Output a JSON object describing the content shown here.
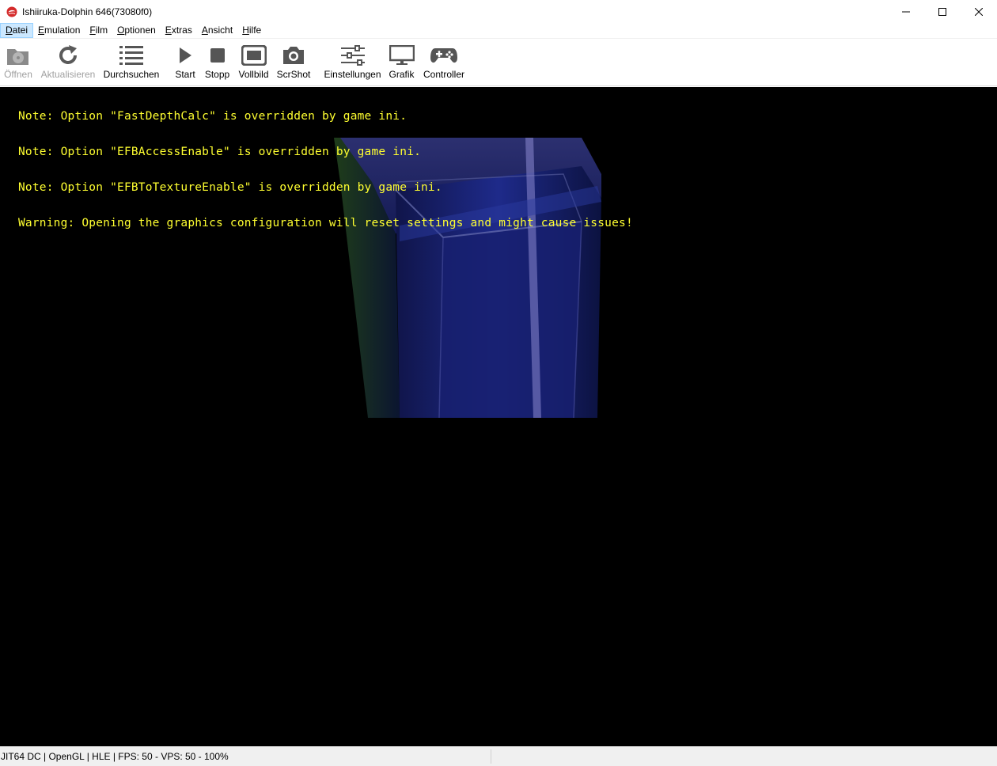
{
  "window": {
    "title": "Ishiiruka-Dolphin 646(73080f0)",
    "app_icon": "dolphin-logo-icon"
  },
  "menu": {
    "items": [
      {
        "label": "Datei",
        "accel": "D",
        "rest": "atei",
        "active": true
      },
      {
        "label": "Emulation",
        "accel": "E",
        "rest": "mulation"
      },
      {
        "label": "Film",
        "accel": "F",
        "rest": "ilm"
      },
      {
        "label": "Optionen",
        "accel": "O",
        "rest": "ptionen"
      },
      {
        "label": "Extras",
        "accel": "E",
        "rest": "xtras"
      },
      {
        "label": "Ansicht",
        "accel": "A",
        "rest": "nsicht"
      },
      {
        "label": "Hilfe",
        "accel": "H",
        "rest": "ilfe"
      }
    ]
  },
  "toolbar": {
    "open": {
      "label": "Öffnen",
      "icon": "open-disc-icon",
      "enabled": false
    },
    "refresh": {
      "label": "Aktualisieren",
      "icon": "refresh-icon",
      "enabled": false
    },
    "browse": {
      "label": "Durchsuchen",
      "icon": "list-icon",
      "enabled": true
    },
    "start": {
      "label": "Start",
      "icon": "play-icon",
      "enabled": true
    },
    "stop": {
      "label": "Stopp",
      "icon": "stop-icon",
      "enabled": true
    },
    "fullscreen": {
      "label": "Vollbild",
      "icon": "fullscreen-icon",
      "enabled": true
    },
    "screenshot": {
      "label": "ScrShot",
      "icon": "camera-icon",
      "enabled": true
    },
    "settings": {
      "label": "Einstellungen",
      "icon": "sliders-icon",
      "enabled": true
    },
    "graphics": {
      "label": "Grafik",
      "icon": "monitor-icon",
      "enabled": true
    },
    "controller": {
      "label": "Controller",
      "icon": "gamepad-icon",
      "enabled": true
    }
  },
  "osd": {
    "lines": [
      "Note: Option \"FastDepthCalc\" is overridden by game ini.",
      "Note: Option \"EFBAccessEnable\" is overridden by game ini.",
      "Note: Option \"EFBToTextureEnable\" is overridden by game ini.",
      "Warning: Opening the graphics configuration will reset settings and might cause issues!"
    ],
    "color": "#ffff30"
  },
  "status": {
    "text": "JIT64 DC | OpenGL | HLE | FPS: 50 - VPS: 50 - 100%"
  },
  "colors": {
    "render_bg": "#000000",
    "menu_active_bg": "#cce8ff"
  }
}
